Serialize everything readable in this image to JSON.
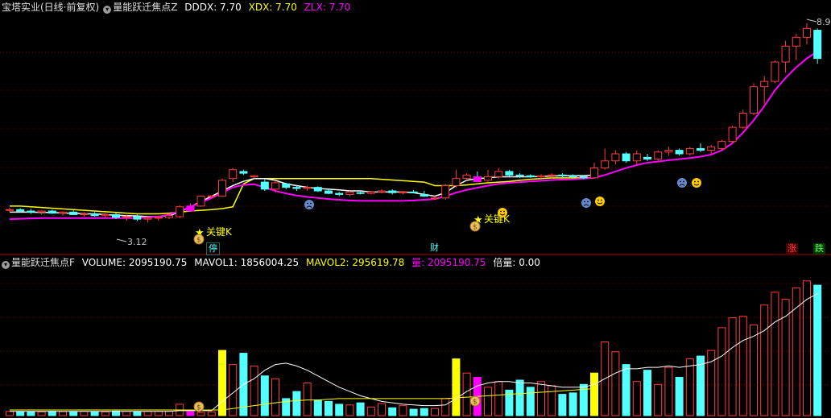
{
  "top_panel": {
    "title": "宝塔实业(日线·前复权)",
    "collapse_icon": "chevron-down-icon",
    "indicator_name": "量能跃迁焦点Z",
    "values": [
      {
        "label": "DDDX: 7.70",
        "color": "#ffffff"
      },
      {
        "label": "XDX: 7.70",
        "color": "#ffff00"
      },
      {
        "label": "ZLX: 7.70",
        "color": "#ff00ff"
      }
    ],
    "high_label": "8.9",
    "low_label": "3.12",
    "signal_text_1": "关键K",
    "signal_text_2": "关键K",
    "marker_ting": "停",
    "marker_cai": "财",
    "badge_zhang": "涨",
    "badge_die": "跌"
  },
  "bottom_panel": {
    "indicator_name": "量能跃迁焦点F",
    "values": [
      {
        "label": "VOLUME: 2095190.75",
        "color": "#ffffff"
      },
      {
        "label": "MAVOL1: 1856004.25",
        "color": "#ffffff"
      },
      {
        "label": "MAVOL2: 295619.78",
        "color": "#ffff00"
      },
      {
        "label": "量: 2095190.75",
        "color": "#ff00ff"
      },
      {
        "label": "倍量: 0.00",
        "color": "#ffffff"
      }
    ]
  },
  "colors": {
    "up": "#ff3c3c",
    "down": "#54ffff",
    "grid": "#8b0000",
    "zlx": "#ff00ff",
    "xdx": "#ffff00",
    "dddx": "#ffffff"
  },
  "chart_data": {
    "type": "candlestick",
    "series": [
      {
        "name": "K",
        "ohlc": [
          [
            3.6,
            3.68,
            3.55,
            3.62
          ],
          [
            3.62,
            3.66,
            3.55,
            3.58
          ],
          [
            3.58,
            3.64,
            3.5,
            3.55
          ],
          [
            3.55,
            3.6,
            3.48,
            3.58
          ],
          [
            3.58,
            3.62,
            3.5,
            3.52
          ],
          [
            3.52,
            3.58,
            3.45,
            3.55
          ],
          [
            3.55,
            3.6,
            3.47,
            3.48
          ],
          [
            3.48,
            3.55,
            3.42,
            3.5
          ],
          [
            3.5,
            3.55,
            3.42,
            3.45
          ],
          [
            3.45,
            3.52,
            3.38,
            3.48
          ],
          [
            3.48,
            3.52,
            3.35,
            3.4
          ],
          [
            3.4,
            3.48,
            3.3,
            3.42
          ],
          [
            3.42,
            3.48,
            3.3,
            3.35
          ],
          [
            3.35,
            3.42,
            3.25,
            3.38
          ],
          [
            3.38,
            3.45,
            3.3,
            3.4
          ],
          [
            3.4,
            3.5,
            3.35,
            3.45
          ],
          [
            3.42,
            3.75,
            3.38,
            3.7
          ],
          [
            3.7,
            3.8,
            3.65,
            3.72
          ],
          [
            3.72,
            4.02,
            3.7,
            4.0
          ],
          [
            4.0,
            4.02,
            3.98,
            4.01
          ],
          [
            4.0,
            4.5,
            3.98,
            4.45
          ],
          [
            4.5,
            4.8,
            4.4,
            4.75
          ],
          [
            4.7,
            4.75,
            4.6,
            4.65
          ],
          [
            4.55,
            4.6,
            4.5,
            4.58
          ],
          [
            4.4,
            4.48,
            4.15,
            4.2
          ],
          [
            4.2,
            4.45,
            4.1,
            4.38
          ],
          [
            4.35,
            4.38,
            4.2,
            4.25
          ],
          [
            4.25,
            4.3,
            4.15,
            4.22
          ],
          [
            4.22,
            4.3,
            4.15,
            4.25
          ],
          [
            4.25,
            4.28,
            4.12,
            4.15
          ],
          [
            4.15,
            4.2,
            4.05,
            4.08
          ],
          [
            4.08,
            4.12,
            4.0,
            4.05
          ],
          [
            4.05,
            4.15,
            4.0,
            4.12
          ],
          [
            4.1,
            4.15,
            4.05,
            4.08
          ],
          [
            4.08,
            4.15,
            4.05,
            4.12
          ],
          [
            4.12,
            4.2,
            4.08,
            4.15
          ],
          [
            4.15,
            4.2,
            4.05,
            4.1
          ],
          [
            4.1,
            4.15,
            4.05,
            4.12
          ],
          [
            4.12,
            4.18,
            4.08,
            4.1
          ],
          [
            4.05,
            4.15,
            3.98,
            4.0
          ],
          [
            3.95,
            4.0,
            3.9,
            3.95
          ],
          [
            3.95,
            4.35,
            3.9,
            4.3
          ],
          [
            4.3,
            4.75,
            4.25,
            4.5
          ],
          [
            4.5,
            4.65,
            4.45,
            4.6
          ],
          [
            4.55,
            4.7,
            4.4,
            4.45
          ],
          [
            4.45,
            4.75,
            4.4,
            4.55
          ],
          [
            4.55,
            4.8,
            4.5,
            4.7
          ],
          [
            4.7,
            4.75,
            4.55,
            4.6
          ],
          [
            4.6,
            4.65,
            4.52,
            4.58
          ],
          [
            4.58,
            4.62,
            4.52,
            4.55
          ],
          [
            4.55,
            4.62,
            4.5,
            4.58
          ],
          [
            4.58,
            4.65,
            4.52,
            4.6
          ],
          [
            4.6,
            4.65,
            4.52,
            4.58
          ],
          [
            4.58,
            4.62,
            4.5,
            4.55
          ],
          [
            4.55,
            4.6,
            4.48,
            4.52
          ],
          [
            4.52,
            4.95,
            4.5,
            4.8
          ],
          [
            4.8,
            5.35,
            4.75,
            5.0
          ],
          [
            5.0,
            5.3,
            4.9,
            5.2
          ],
          [
            5.2,
            5.25,
            4.95,
            5.0
          ],
          [
            5.0,
            5.3,
            4.9,
            5.2
          ],
          [
            5.1,
            5.2,
            5.0,
            5.05
          ],
          [
            5.05,
            5.3,
            5.0,
            5.25
          ],
          [
            5.25,
            5.4,
            5.15,
            5.3
          ],
          [
            5.3,
            5.35,
            5.15,
            5.2
          ],
          [
            5.2,
            5.4,
            5.15,
            5.35
          ],
          [
            5.35,
            5.5,
            5.25,
            5.3
          ],
          [
            5.3,
            5.45,
            5.2,
            5.4
          ],
          [
            5.35,
            5.6,
            5.3,
            5.55
          ],
          [
            5.55,
            6.0,
            5.5,
            5.95
          ],
          [
            5.95,
            6.45,
            5.9,
            6.35
          ],
          [
            6.35,
            7.2,
            6.3,
            7.1
          ],
          [
            7.1,
            7.4,
            6.6,
            7.25
          ],
          [
            7.25,
            7.85,
            7.2,
            7.8
          ],
          [
            7.8,
            8.4,
            7.5,
            8.25
          ],
          [
            8.25,
            8.6,
            7.85,
            8.5
          ],
          [
            8.5,
            8.9,
            8.3,
            8.75
          ],
          [
            8.7,
            8.75,
            7.75,
            7.9
          ]
        ]
      },
      {
        "name": "ZLX",
        "values": [
          3.35,
          3.36,
          3.37,
          3.38,
          3.38,
          3.38,
          3.38,
          3.38,
          3.38,
          3.38,
          3.38,
          3.38,
          3.38,
          3.4,
          3.42,
          3.48,
          3.58,
          3.7,
          3.82,
          3.95,
          4.1,
          4.25,
          4.32,
          4.34,
          4.25,
          4.15,
          4.08,
          4.02,
          3.98,
          3.95,
          3.92,
          3.9,
          3.88,
          3.87,
          3.87,
          3.87,
          3.87,
          3.87,
          3.88,
          3.9,
          3.92,
          4.0,
          4.1,
          4.18,
          4.24,
          4.3,
          4.35,
          4.38,
          4.4,
          4.42,
          4.44,
          4.46,
          4.47,
          4.48,
          4.5,
          4.52,
          4.6,
          4.7,
          4.8,
          4.88,
          4.95,
          4.98,
          5.02,
          5.05,
          5.08,
          5.12,
          5.18,
          5.3,
          5.5,
          5.8,
          6.15,
          6.55,
          7.0,
          7.35,
          7.65,
          7.9,
          8.1
        ]
      },
      {
        "name": "XDX",
        "values": [
          3.72,
          3.72,
          3.7,
          3.68,
          3.66,
          3.64,
          3.62,
          3.6,
          3.58,
          3.56,
          3.54,
          3.52,
          3.5,
          3.5,
          3.5,
          3.52,
          3.55,
          3.58,
          3.6,
          3.62,
          3.65,
          3.7,
          4.35,
          4.5,
          4.5,
          4.5,
          4.5,
          4.5,
          4.5,
          4.5,
          4.5,
          4.5,
          4.5,
          4.5,
          4.5,
          4.48,
          4.46,
          4.44,
          4.42,
          4.4,
          4.3,
          4.3,
          4.3,
          4.32,
          4.35,
          4.38,
          4.4,
          4.42,
          4.45,
          4.48,
          4.5,
          4.52,
          4.52,
          4.52,
          4.52,
          4.52
        ]
      },
      {
        "name": "DDDX",
        "values": [
          3.55,
          3.55,
          3.55,
          3.54,
          3.54,
          3.52,
          3.52,
          3.5,
          3.5,
          3.48,
          3.46,
          3.45,
          3.44,
          3.42,
          3.42,
          3.45,
          3.55,
          3.7,
          3.85,
          4.0,
          4.15,
          4.3,
          4.42,
          4.5,
          4.5,
          4.45,
          4.35,
          4.3,
          4.25,
          4.22,
          4.2,
          4.18,
          4.15,
          4.15,
          4.12,
          4.12,
          4.12,
          4.12,
          4.1,
          4.05,
          4.0,
          4.1,
          4.3,
          4.45,
          4.5,
          4.52,
          4.55,
          4.55,
          4.55,
          4.55,
          4.56,
          4.57,
          4.58,
          4.58,
          4.58,
          4.6
        ]
      },
      {
        "name": "VOLUME",
        "values": [
          0.3,
          0.28,
          0.28,
          0.26,
          0.3,
          0.28,
          0.26,
          0.3,
          0.28,
          0.26,
          0.32,
          0.3,
          0.28,
          0.3,
          0.3,
          0.3,
          0.8,
          0.28,
          0.22,
          0.25,
          4.6,
          3.6,
          4.4,
          3.5,
          2.8,
          2.6,
          1.2,
          1.7,
          2.3,
          1.1,
          1.0,
          0.8,
          0.75,
          0.9,
          0.6,
          0.85,
          0.55,
          0.7,
          0.45,
          0.5,
          0.5,
          1.2,
          4.0,
          3.0,
          2.7,
          2.0,
          2.4,
          1.8,
          2.5,
          2.0,
          2.4,
          2.1,
          1.5,
          1.6,
          2.2,
          3.0,
          5.2,
          4.5,
          3.6,
          2.4,
          3.2,
          2.2,
          3.4,
          2.7,
          4.0,
          4.2,
          4.6,
          6.2,
          6.9,
          7.0,
          6.4,
          7.8,
          8.7,
          8.2,
          9.0,
          9.5,
          9.2
        ]
      },
      {
        "name": "MAVOL1",
        "values": [
          0.3,
          0.3,
          0.3,
          0.3,
          0.3,
          0.3,
          0.3,
          0.3,
          0.3,
          0.3,
          0.3,
          0.3,
          0.3,
          0.3,
          0.3,
          0.3,
          0.35,
          0.35,
          0.35,
          0.35,
          1.0,
          1.6,
          2.2,
          2.6,
          3.2,
          3.6,
          3.7,
          3.5,
          3.2,
          2.8,
          2.4,
          2.0,
          1.7,
          1.4,
          1.2,
          1.0,
          0.9,
          0.8,
          0.75,
          0.7,
          0.7,
          0.75,
          1.2,
          1.7,
          2.1,
          2.3,
          2.4,
          2.4,
          2.3,
          2.3,
          2.2,
          2.1,
          2.0,
          2.0,
          2.0,
          2.2,
          2.6,
          3.0,
          3.3,
          3.3,
          3.4,
          3.4,
          3.5,
          3.4,
          3.5,
          3.6,
          3.8,
          4.2,
          4.8,
          5.3,
          5.6,
          6.0,
          6.6,
          7.0,
          7.6,
          8.2,
          8.6
        ]
      },
      {
        "name": "MAVOL2",
        "values": [
          0.4,
          0.4,
          0.4,
          0.4,
          0.4,
          0.4,
          0.4,
          0.4,
          0.4,
          0.4,
          0.4,
          0.4,
          0.4,
          0.4,
          0.4,
          0.4,
          0.4,
          0.4,
          0.4,
          0.4,
          0.4,
          0.5,
          0.6,
          0.7,
          0.8,
          0.9,
          1.0,
          1.05,
          1.1,
          1.1,
          1.15,
          1.2,
          1.2,
          1.2,
          1.2,
          1.2,
          1.2,
          1.2,
          1.2,
          1.2,
          1.2,
          1.2,
          1.25,
          1.3,
          1.35,
          1.4,
          1.45,
          1.5,
          1.55,
          1.6,
          1.65,
          1.7,
          1.75,
          1.8,
          1.85,
          1.9
        ]
      }
    ]
  }
}
